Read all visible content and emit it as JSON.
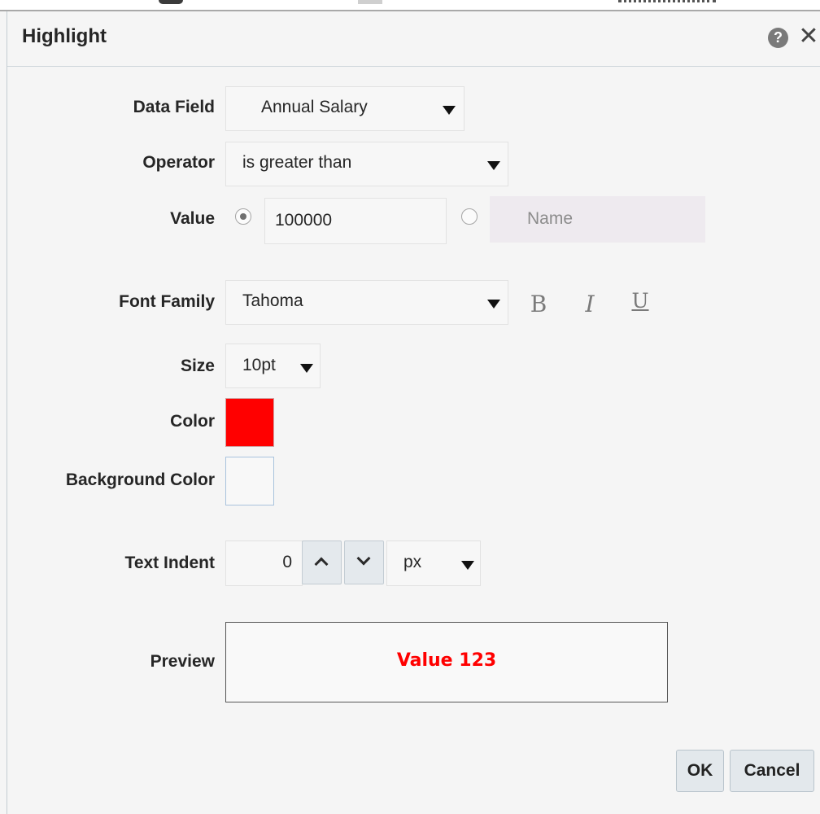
{
  "dialog": {
    "title": "Highlight",
    "help_icon": "question-circle-icon",
    "close_icon": "close-icon"
  },
  "form": {
    "data_field": {
      "label": "Data Field",
      "value": "Annual Salary"
    },
    "operator": {
      "label": "Operator",
      "value": "is greater than"
    },
    "value": {
      "label": "Value",
      "number_value": "100000",
      "number_selected": true,
      "name_placeholder": "Name",
      "name_selected": false
    },
    "font_family": {
      "label": "Font Family",
      "value": "Tahoma"
    },
    "style_buttons": {
      "bold": "B",
      "italic": "I",
      "underline": "U"
    },
    "size": {
      "label": "Size",
      "value": "10pt"
    },
    "color": {
      "label": "Color",
      "swatch": "#ff0000"
    },
    "background_color": {
      "label": "Background Color",
      "swatch": "#f8f8f8"
    },
    "text_indent": {
      "label": "Text Indent",
      "value": "0",
      "unit": "px"
    },
    "preview": {
      "label": "Preview",
      "text": "Value 123",
      "color": "#ff0000"
    }
  },
  "footer": {
    "ok": "OK",
    "cancel": "Cancel"
  }
}
